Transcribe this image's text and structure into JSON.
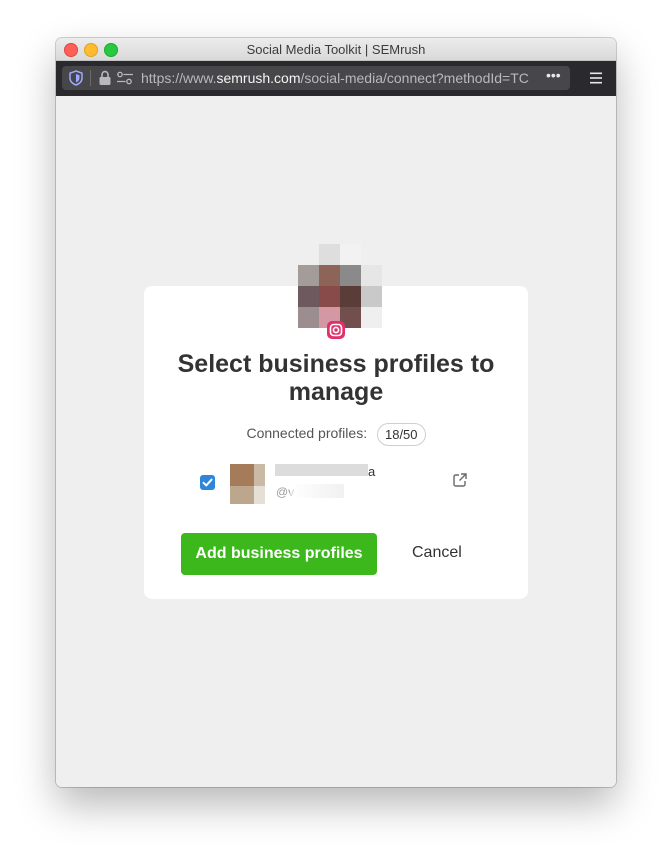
{
  "window": {
    "title": "Social Media Toolkit | SEMrush"
  },
  "urlbar": {
    "url_prefix": "https://www.",
    "url_domain": "semrush.com",
    "url_path": "/social-media/connect?methodId=TC",
    "more_label": "•••"
  },
  "dialog": {
    "heading": "Select business profiles to manage",
    "connected_label": "Connected profiles:",
    "connected_count": "18/50",
    "profile": {
      "name_tail": "a",
      "handle_prefix": "@v"
    },
    "add_button_label": "Add business profiles",
    "cancel_label": "Cancel"
  },
  "colors": {
    "accent_green": "#3cb81c",
    "checkbox_blue": "#2d86d9",
    "instagram": "#e1306c"
  }
}
